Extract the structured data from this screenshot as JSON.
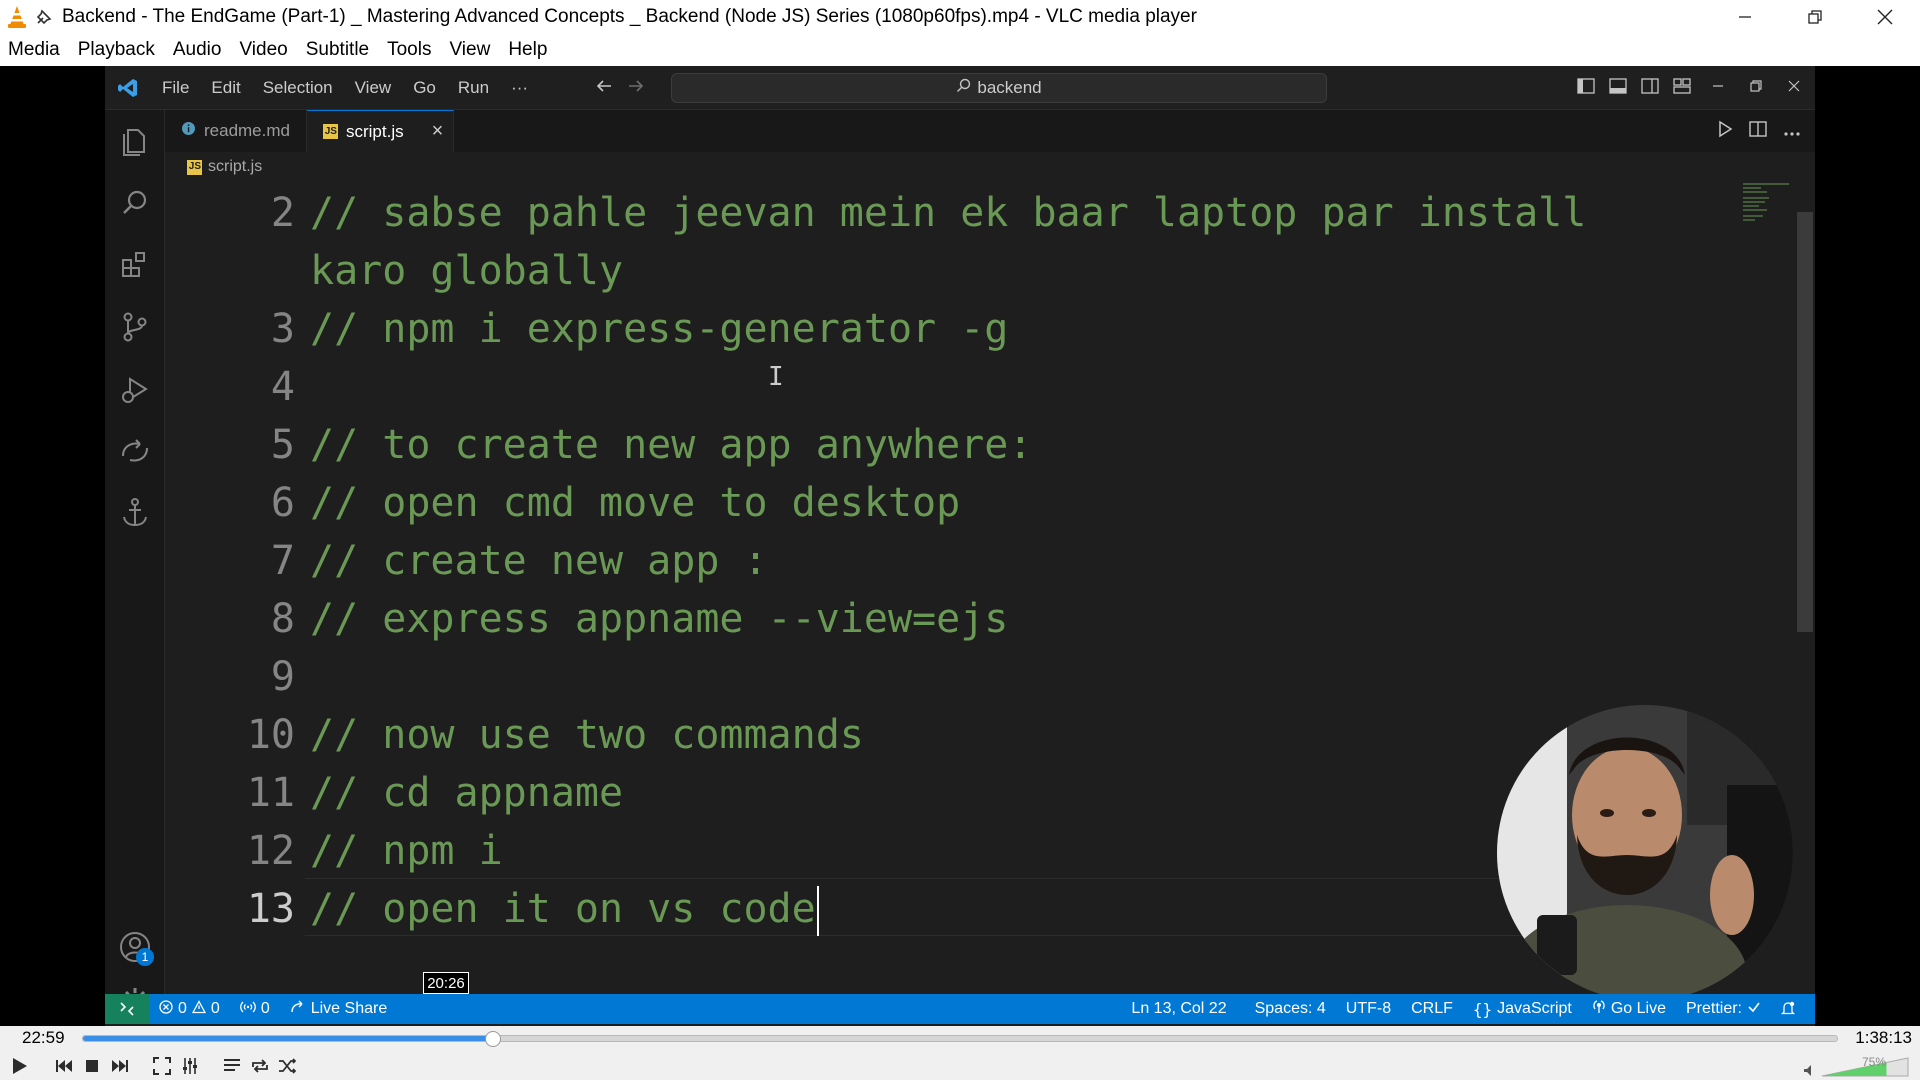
{
  "vlc": {
    "window_title": "Backend - The EndGame (Part-1) _ Mastering Advanced Concepts _ Backend (Node JS) Series (1080p60fps).mp4 - VLC media player",
    "menu": [
      "Media",
      "Playback",
      "Audio",
      "Video",
      "Subtitle",
      "Tools",
      "View",
      "Help"
    ],
    "elapsed": "22:59",
    "duration": "1:38:13",
    "progress_fraction": 0.234,
    "seek_hover_time": "20:26",
    "volume_percent": "75%",
    "volume_fraction": 0.75
  },
  "vscode": {
    "menu": [
      "File",
      "Edit",
      "Selection",
      "View",
      "Go",
      "Run",
      "···"
    ],
    "search_text": "backend",
    "tabs": [
      {
        "label": "readme.md",
        "active": false
      },
      {
        "label": "script.js",
        "active": true
      }
    ],
    "tab_close": "×",
    "js_badge": "JS",
    "breadcrumb": "script.js",
    "account_badge": "1",
    "code_lines": [
      {
        "number": "2",
        "text": "// sabse pahle jeevan mein ek baar laptop par install"
      },
      {
        "number": "",
        "text": "karo globally"
      },
      {
        "number": "3",
        "text": "// npm i express-generator -g"
      },
      {
        "number": "4",
        "text": ""
      },
      {
        "number": "5",
        "text": "// to create new app anywhere:"
      },
      {
        "number": "6",
        "text": "// open cmd move to desktop"
      },
      {
        "number": "7",
        "text": "// create new app :"
      },
      {
        "number": "8",
        "text": "// express appname --view=ejs"
      },
      {
        "number": "9",
        "text": ""
      },
      {
        "number": "10",
        "text": "// now use two commands"
      },
      {
        "number": "11",
        "text": "// cd appname"
      },
      {
        "number": "12",
        "text": "// npm i"
      },
      {
        "number": "13",
        "text": "// open it on vs code"
      }
    ],
    "status": {
      "errors": "0",
      "warnings": "0",
      "ports": "0",
      "live_share": "Live Share",
      "position": "Ln 13, Col 22",
      "spaces": "Spaces: 4",
      "encoding": "UTF-8",
      "eol": "CRLF",
      "language": "JavaScript",
      "go_live": "Go Live",
      "prettier": "Prettier:"
    },
    "colors": {
      "comment": "#6a9955",
      "status_bar": "#0078d4",
      "editor_bg": "#1e1e1e"
    }
  }
}
